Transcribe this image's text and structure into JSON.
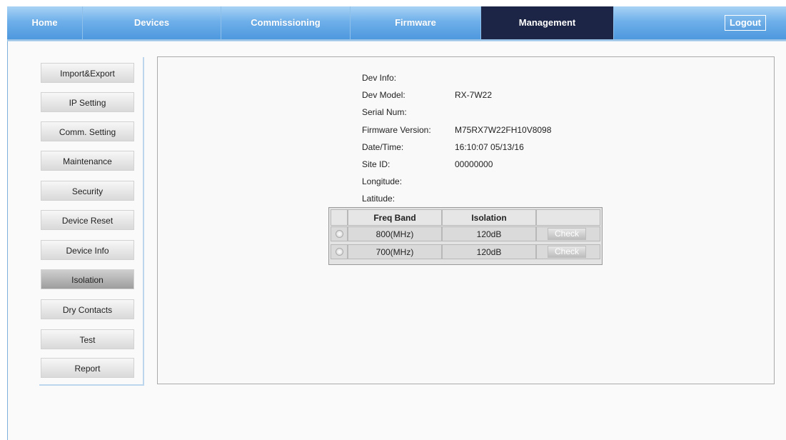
{
  "nav": {
    "tabs": [
      {
        "label": "Home"
      },
      {
        "label": "Devices"
      },
      {
        "label": "Commissioning"
      },
      {
        "label": "Firmware"
      },
      {
        "label": "Management"
      }
    ],
    "active_tab": "Management",
    "logout_label": "Logout"
  },
  "sidebar": {
    "items": [
      {
        "label": "Import&Export"
      },
      {
        "label": "IP Setting"
      },
      {
        "label": "Comm. Setting"
      },
      {
        "label": "Maintenance"
      },
      {
        "label": "Security"
      },
      {
        "label": "Device Reset"
      },
      {
        "label": "Device Info"
      },
      {
        "label": "Isolation"
      },
      {
        "label": "Dry Contacts"
      },
      {
        "label": "Test"
      },
      {
        "label": "Report"
      }
    ],
    "active_item": "Isolation"
  },
  "dev_info": {
    "title": "Dev Info:",
    "model_label": "Dev Model:",
    "model_value": "RX-7W22",
    "serial_label": "Serial Num:",
    "serial_value": "",
    "firmware_label": "Firmware Version:",
    "firmware_value": "M75RX7W22FH10V8098",
    "datetime_label": "Date/Time:",
    "datetime_value": "16:10:07 05/13/16",
    "site_label": "Site ID:",
    "site_value": "00000000",
    "longitude_label": "Longitude:",
    "longitude_value": "",
    "latitude_label": "Latitude:",
    "latitude_value": ""
  },
  "isolation_table": {
    "headers": [
      "Freq Band",
      "Isolation"
    ],
    "rows": [
      {
        "band": "800(MHz)",
        "isolation": "120dB",
        "button": "Check"
      },
      {
        "band": "700(MHz)",
        "isolation": "120dB",
        "button": "Check"
      }
    ]
  },
  "colors": {
    "nav_gradient_top": "#a9d3f5",
    "nav_gradient_bottom": "#4d98de",
    "active_tab": "#1c2545"
  }
}
